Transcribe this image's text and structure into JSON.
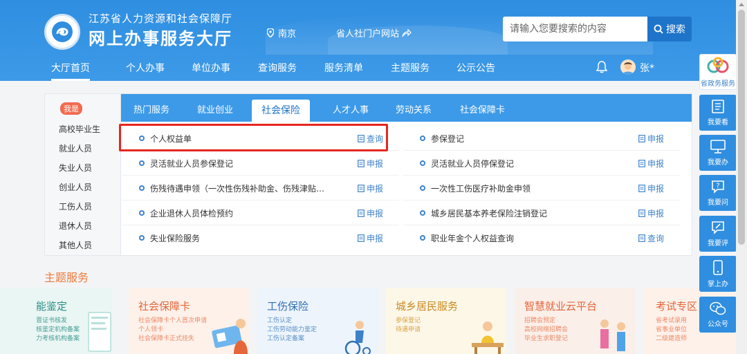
{
  "header": {
    "org_name": "江苏省人力资源和社会保障厅",
    "hall_name": "网上办事服务大厅",
    "location": "南京",
    "portal_link": "省人社门户网站",
    "search_placeholder": "请输入您要搜索的内容",
    "search_button": "搜索",
    "user_name": "张*"
  },
  "nav": [
    "大厅首页",
    "个人办事",
    "单位办事",
    "查询服务",
    "服务清单",
    "主题服务",
    "公示公告"
  ],
  "left": {
    "badge": "我是",
    "items": [
      "高校毕业生",
      "就业人员",
      "失业人员",
      "创业人员",
      "工伤人员",
      "退休人员",
      "其他人员"
    ]
  },
  "tabs": [
    "热门服务",
    "就业创业",
    "社会保险",
    "人才人事",
    "劳动关系",
    "社会保障卡"
  ],
  "services": {
    "left": [
      {
        "name": "个人权益单",
        "action": "查询"
      },
      {
        "name": "灵活就业人员参保登记",
        "action": "申报"
      },
      {
        "name": "伤残待遇申领（一次性伤残补助金、伤残津贴…",
        "action": "申报"
      },
      {
        "name": "企业退休人员体检预约",
        "action": "申报"
      },
      {
        "name": "失业保险服务",
        "action": "申报"
      }
    ],
    "right": [
      {
        "name": "参保登记",
        "action": "申报"
      },
      {
        "name": "灵活就业人员停保登记",
        "action": "申报"
      },
      {
        "name": "一次性工伤医疗补助金申领",
        "action": "申报"
      },
      {
        "name": "城乡居民基本养老保险注销登记",
        "action": "申报"
      },
      {
        "name": "职业年金个人权益查询",
        "action": "查询"
      }
    ]
  },
  "theme": {
    "title": "主题服务",
    "cards": [
      {
        "title": "能鉴定",
        "lines": [
          "晋证书核发",
          "核鉴定机构备案",
          "力考核机构备案"
        ]
      },
      {
        "title": "社会保障卡",
        "lines": [
          "社会保障卡个人首次申请",
          "个人领卡",
          "社会保障卡正式挂失"
        ]
      },
      {
        "title": "工伤保险",
        "lines": [
          "工伤认定",
          "工伤劳动能力鉴定",
          "工伤认定备案"
        ]
      },
      {
        "title": "城乡居民服务",
        "lines": [
          "参保登记",
          "待遇申请"
        ]
      },
      {
        "title": "智慧就业云平台",
        "lines": [
          "招聘会预定",
          "高校网络招聘会",
          "毕业生求职登记"
        ]
      },
      {
        "title": "考试专区",
        "lines": [
          "省考试录用",
          "省事业单位",
          "二级建造师"
        ]
      }
    ]
  },
  "rail": [
    "省政务服务",
    "我要看",
    "我要办",
    "我要问",
    "我要评",
    "掌上办",
    "公众号"
  ],
  "colors": {
    "brand": "#3d9ae8",
    "accent": "#f07a3c",
    "highlight": "#e5261f"
  }
}
